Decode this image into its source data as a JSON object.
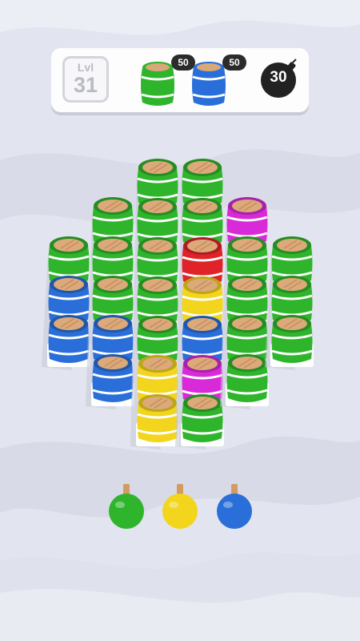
{
  "hud": {
    "level_label": "Lvl",
    "level_number": "31",
    "goals": [
      {
        "color_name": "green",
        "count": "50",
        "color": "#2fb52c"
      },
      {
        "color_name": "blue",
        "count": "50",
        "color": "#2a6fd9"
      }
    ],
    "bomb_moves": "30"
  },
  "colors": {
    "green": "#2fb52c",
    "blue": "#2a6fd9",
    "red": "#e02229",
    "magenta": "#d82ad8",
    "yellow": "#f2d51c"
  },
  "board": {
    "columns": [
      {
        "barrels": [
          "green",
          "blue",
          "blue"
        ]
      },
      {
        "barrels": [
          "green",
          "green",
          "green",
          "blue",
          "blue"
        ]
      },
      {
        "barrels": [
          "green",
          "green",
          "green",
          "green",
          "green",
          "yellow",
          "yellow"
        ]
      },
      {
        "barrels": [
          "green",
          "green",
          "red",
          "yellow",
          "blue",
          "magenta",
          "green"
        ]
      },
      {
        "barrels": [
          "magenta",
          "green",
          "green",
          "green",
          "green"
        ]
      },
      {
        "barrels": [
          "green",
          "green",
          "green"
        ]
      }
    ]
  },
  "shooters": [
    {
      "color_name": "green"
    },
    {
      "color_name": "yellow"
    },
    {
      "color_name": "blue"
    }
  ]
}
